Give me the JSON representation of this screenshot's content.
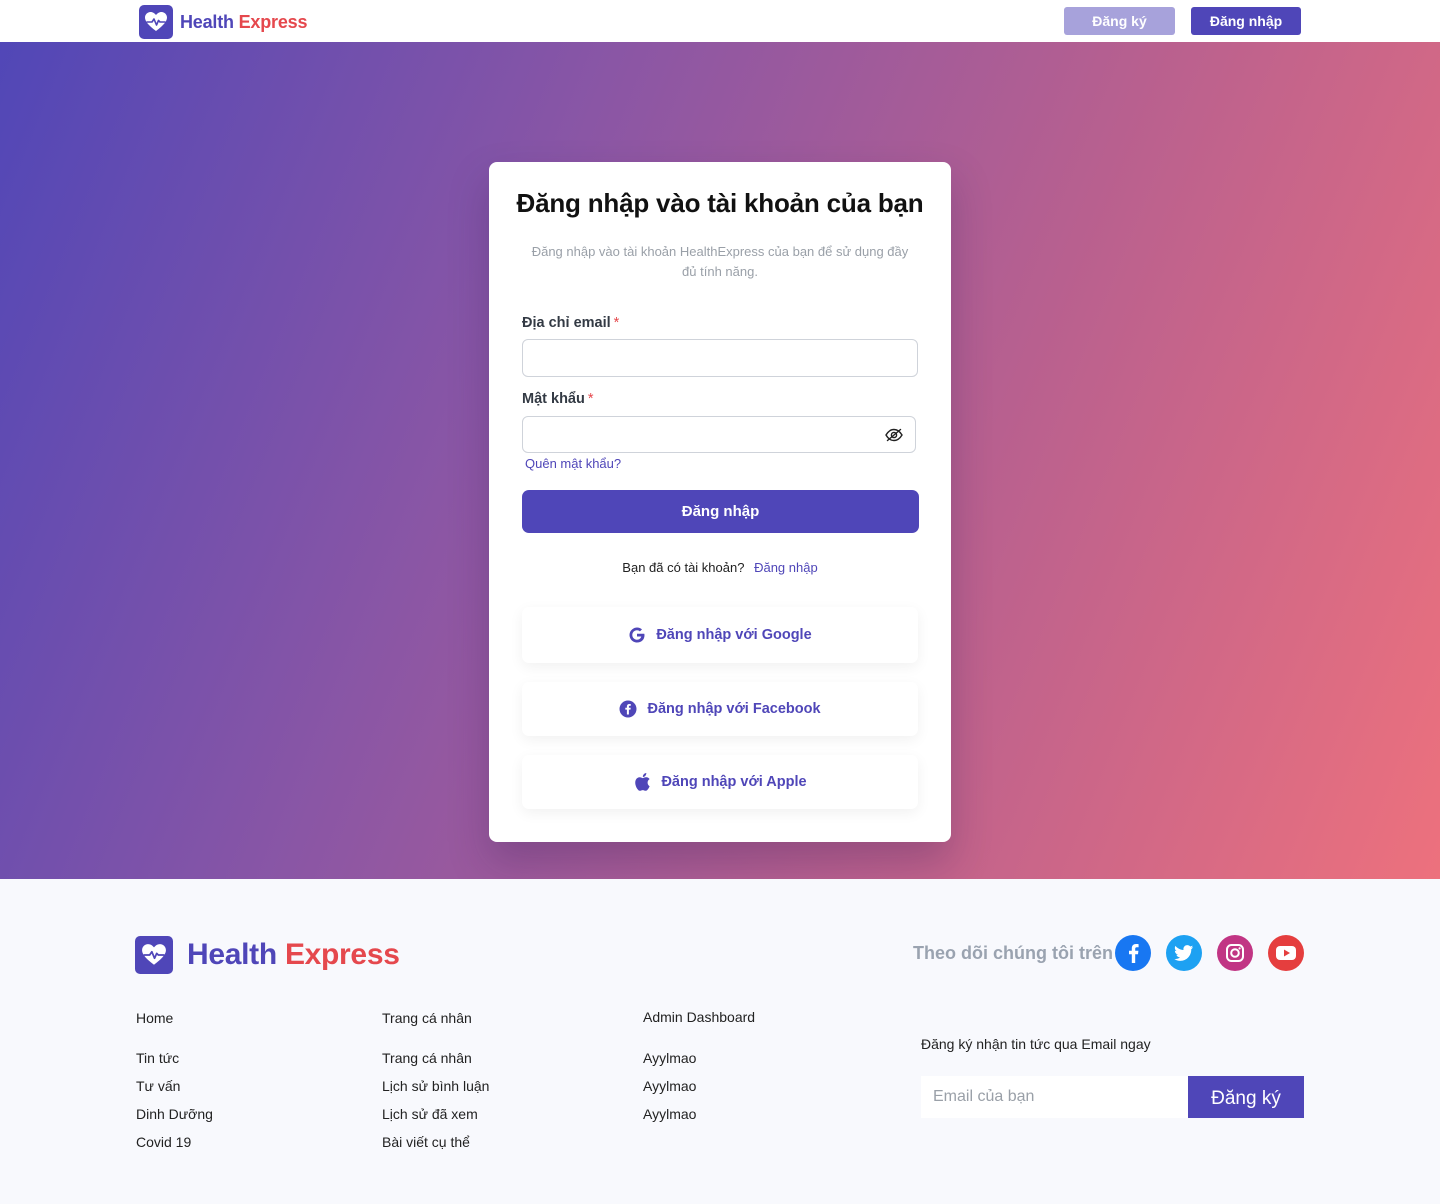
{
  "header": {
    "brand_part1": "Health",
    "brand_part2": "Express",
    "register_label": "Đăng ký",
    "login_label": "Đăng nhập"
  },
  "login_card": {
    "title": "Đăng nhập vào tài khoản của bạn",
    "subtitle": "Đăng nhập vào tài khoản HealthExpress của bạn để sử dụng đầy đủ tính năng.",
    "email_label": "Địa chỉ email",
    "password_label": "Mật khẩu",
    "required_mark": "*",
    "email_value": "",
    "password_value": "",
    "forgot_link": "Quên mật khẩu?",
    "submit_label": "Đăng nhập",
    "have_account_text": "Bạn đã có tài khoản?",
    "have_account_link": "Đăng nhập",
    "social": [
      {
        "label": "Đăng nhập với Google",
        "icon": "google-icon"
      },
      {
        "label": "Đăng nhập với Facebook",
        "icon": "facebook-icon"
      },
      {
        "label": "Đăng nhập với Apple",
        "icon": "apple-icon"
      }
    ]
  },
  "footer": {
    "brand_part1": "Health",
    "brand_part2": "Express",
    "follow_text": "Theo dõi chúng tôi trên",
    "socials": [
      "facebook-icon",
      "twitter-icon",
      "instagram-icon",
      "youtube-icon"
    ],
    "columns": [
      {
        "title": "Home",
        "items": [
          "Tin tức",
          "Tư vấn",
          "Dinh Dưỡng",
          "Covid 19"
        ]
      },
      {
        "title": "Trang cá nhân",
        "items": [
          "Trang cá nhân",
          "Lịch sử bình luận",
          "Lịch sử đã xem",
          "Bài viết cụ thể"
        ]
      },
      {
        "title": "Admin Dashboard",
        "items": [
          "Ayylmao",
          "Ayylmao",
          "Ayylmao"
        ]
      }
    ],
    "newsletter_label": "Đăng ký nhận tin tức qua Email ngay",
    "newsletter_placeholder": "Email của bạn",
    "newsletter_button": "Đăng ký"
  },
  "colors": {
    "primary": "#4f46b8",
    "accent": "#e5484d",
    "gradient_start": "#5147b7",
    "gradient_end": "#ed717d"
  }
}
